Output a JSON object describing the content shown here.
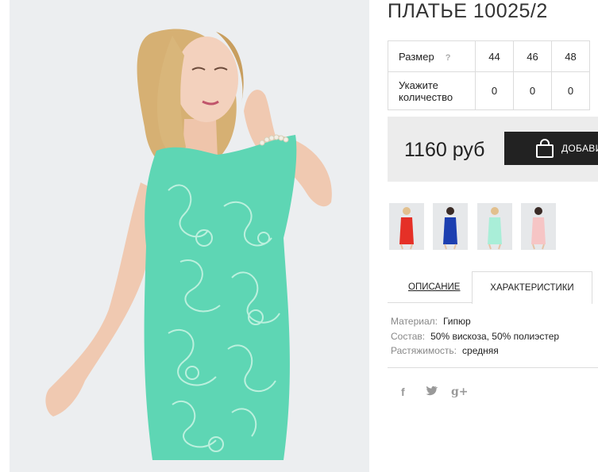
{
  "product": {
    "title": "ПЛАТЬЕ 10025/2",
    "dress_color": "#5ed6b4"
  },
  "sizes": {
    "size_label": "Размер",
    "help_mark": "?",
    "qty_label_line1": "Укажите",
    "qty_label_line2": "количество",
    "values": [
      "44",
      "46",
      "48"
    ],
    "quantities": [
      "0",
      "0",
      "0"
    ]
  },
  "purchase": {
    "price": "1160 руб",
    "add_label": "ДОБАВИТЬ"
  },
  "variants": [
    {
      "color": "#e53027",
      "icon": "red-dress-thumbnail"
    },
    {
      "color": "#1c3fb0",
      "icon": "blue-dress-thumbnail"
    },
    {
      "color": "#a9eed8",
      "icon": "mint-dress-thumbnail"
    },
    {
      "color": "#f6c5c5",
      "icon": "pink-dress-thumbnail"
    }
  ],
  "tabs": {
    "description": "ОПИСАНИЕ",
    "characteristics": "ХАРАКТЕРИСТИКИ"
  },
  "specs": {
    "material_key": "Материал:",
    "material_val": "Гипюр",
    "composition_key": "Состав:",
    "composition_val": "50% вискоза, 50% полиэстер",
    "stretch_key": "Растяжимость:",
    "stretch_val": "средняя"
  },
  "social": {
    "facebook": "f",
    "googleplus": "g+"
  }
}
